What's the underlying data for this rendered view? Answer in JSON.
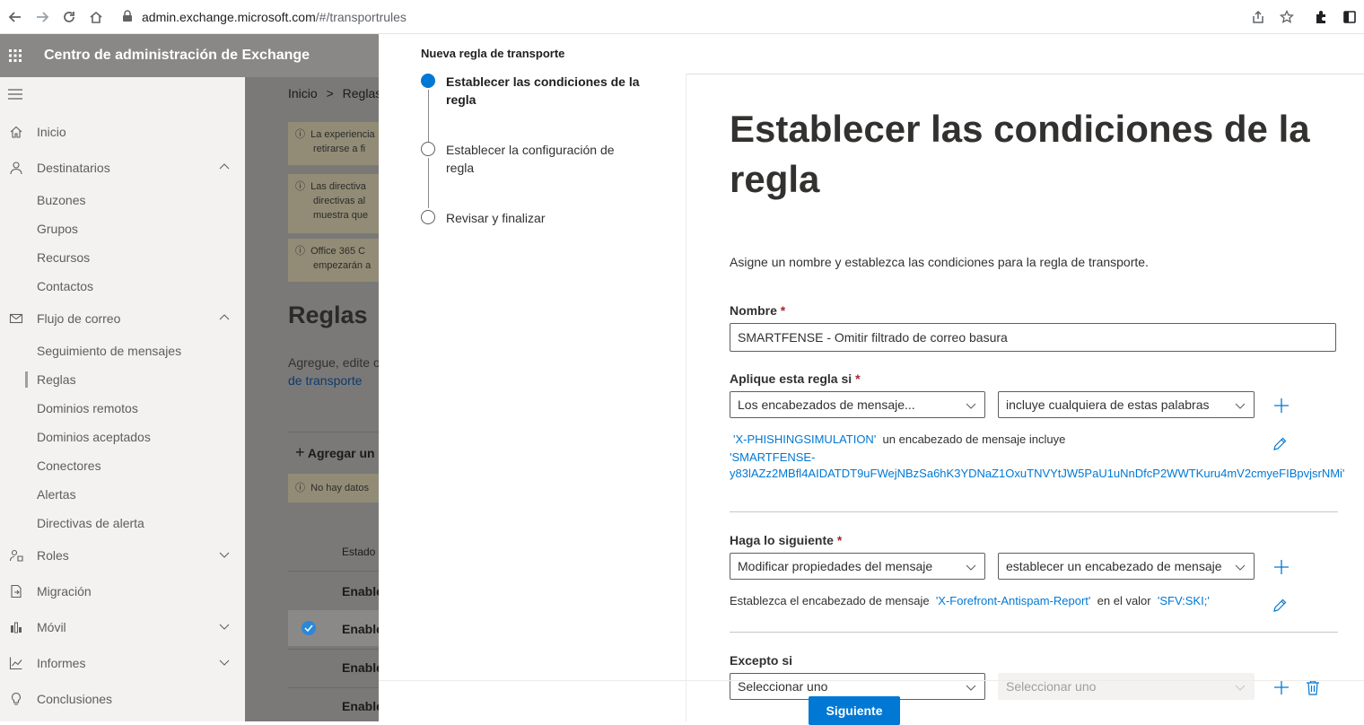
{
  "browser": {
    "url_host": "admin.exchange.microsoft.com",
    "url_path": "/#/transportrules"
  },
  "app": {
    "title": "Centro de administración de Exchange"
  },
  "leftnav": {
    "items": [
      {
        "label": "Inicio",
        "icon": "home-icon"
      },
      {
        "label": "Destinatarios",
        "icon": "person-icon"
      },
      {
        "label": "Flujo de correo",
        "icon": "mail-icon"
      },
      {
        "label": "Roles",
        "icon": "roles-icon"
      },
      {
        "label": "Migración",
        "icon": "migration-icon"
      },
      {
        "label": "Móvil",
        "icon": "mobile-icon"
      },
      {
        "label": "Informes",
        "icon": "chart-icon"
      },
      {
        "label": "Conclusiones",
        "icon": "lightbulb-icon"
      }
    ],
    "recipients_sub": [
      "Buzones",
      "Grupos",
      "Recursos",
      "Contactos"
    ],
    "mailflow_sub": [
      "Seguimiento de mensajes",
      "Reglas",
      "Dominios remotos",
      "Dominios aceptados",
      "Conectores",
      "Alertas",
      "Directivas de alerta"
    ]
  },
  "background": {
    "breadcrumb_home": "Inicio",
    "breadcrumb_sep": ">",
    "breadcrumb_current": "Reglas",
    "messages": [
      {
        "line1": "La experiencia",
        "line2": "retirarse a fi"
      },
      {
        "line1": "Las directiva",
        "line2": "directivas al",
        "line3": "muestra que"
      },
      {
        "line1": "Office 365 C",
        "line2": "empezarán a"
      },
      {
        "line1": "No hay datos"
      }
    ],
    "heading": "Reglas",
    "desc_line1": "Agregue, edite o",
    "desc_link": "de transporte",
    "add_button": "Agregar un",
    "col_status": "Estado",
    "row_value": "Enable"
  },
  "panel": {
    "title": "Nueva regla de transporte",
    "steps": [
      {
        "label": "Establecer las condiciones de la regla",
        "current": true
      },
      {
        "label": "Establecer la configuración de regla",
        "current": false
      },
      {
        "label": "Revisar y finalizar",
        "current": false
      }
    ],
    "heading": "Establecer las condiciones de la regla",
    "intro": "Asigne un nombre y establezca las condiciones para la regla de transporte.",
    "name_label": "Nombre",
    "required_mark": "*",
    "name_value": "SMARTFENSE - Omitir filtrado de correo basura",
    "apply_label": "Aplique esta regla si",
    "apply_dropdown1": "Los encabezados de mensaje...",
    "apply_dropdown2": "incluye cualquiera de estas palabras",
    "apply_cond_header": "'X-PHISHINGSIMULATION'",
    "apply_cond_mid": "un encabezado de mensaje incluye",
    "apply_cond_value1": "'SMARTFENSE-",
    "apply_cond_value2": "y83lAZz2MBfl4AIDATDT9uFWejNBzSa6hK3YDNaZ1OxuTNVYtJW5PaU1uNnDfcP2WWTKuru4mV2cmyeFIBpvjsrNMi'",
    "do_label": "Haga lo siguiente",
    "do_dropdown1": "Modificar propiedades del mensaje",
    "do_dropdown2": "establecer un encabezado de mensaje",
    "do_cond_prefix": "Establezca el encabezado de mensaje",
    "do_cond_header": "'X-Forefront-Antispam-Report'",
    "do_cond_mid": "en el valor",
    "do_cond_value": "'SFV:SKI;'",
    "except_label": "Excepto si",
    "except_dropdown1": "Seleccionar uno",
    "except_dropdown2": "Seleccionar uno",
    "next_button": "Siguiente"
  },
  "colors": {
    "accent": "#0078d4",
    "header_dim": "#8a8886",
    "required": "#a4262c"
  }
}
